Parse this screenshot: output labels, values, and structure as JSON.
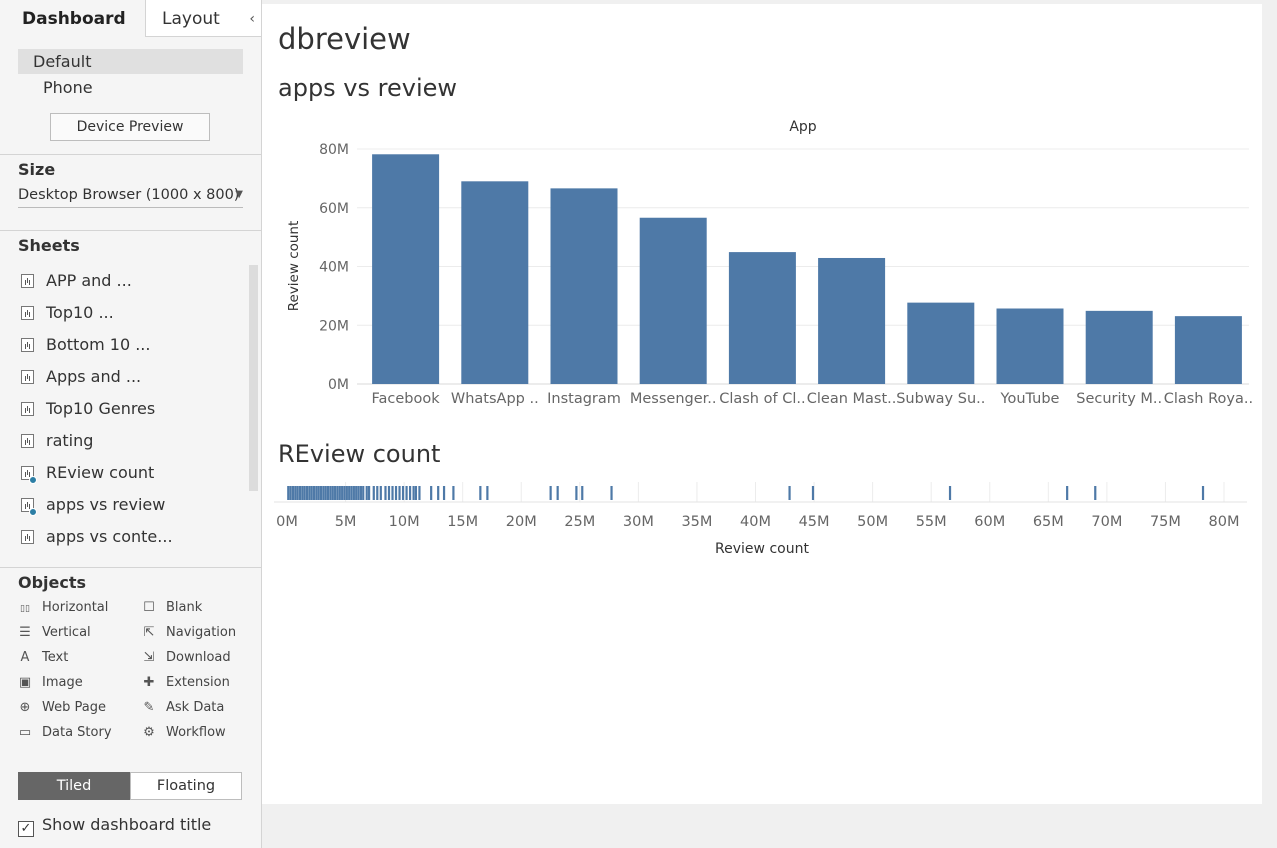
{
  "left_panel": {
    "tabs": {
      "dashboard": "Dashboard",
      "layout": "Layout",
      "collapse": "‹"
    },
    "device": {
      "default": "Default",
      "phone": "Phone",
      "preview_button": "Device Preview"
    },
    "size": {
      "heading": "Size",
      "value": "Desktop Browser (1000 x 800)"
    },
    "sheets": {
      "heading": "Sheets",
      "items": [
        {
          "label": "APP and ...",
          "used": false
        },
        {
          "label": "Top10 ...",
          "used": false
        },
        {
          "label": "Bottom 10 ...",
          "used": false
        },
        {
          "label": "Apps and ...",
          "used": false
        },
        {
          "label": "Top10 Genres",
          "used": false
        },
        {
          "label": "rating",
          "used": false
        },
        {
          "label": "REview count",
          "used": true
        },
        {
          "label": "apps vs review",
          "used": true
        },
        {
          "label": "apps vs conte...",
          "used": false
        }
      ]
    },
    "objects": {
      "heading": "Objects",
      "items": [
        {
          "label": "Horizontal",
          "icon": "horizontal-icon"
        },
        {
          "label": "Blank",
          "icon": "blank-icon"
        },
        {
          "label": "Vertical",
          "icon": "vertical-icon"
        },
        {
          "label": "Navigation",
          "icon": "navigation-icon"
        },
        {
          "label": "Text",
          "icon": "text-icon"
        },
        {
          "label": "Download",
          "icon": "download-icon"
        },
        {
          "label": "Image",
          "icon": "image-icon"
        },
        {
          "label": "Extension",
          "icon": "extension-icon"
        },
        {
          "label": "Web Page",
          "icon": "web-page-icon"
        },
        {
          "label": "Ask Data",
          "icon": "ask-data-icon"
        },
        {
          "label": "Data Story",
          "icon": "data-story-icon"
        },
        {
          "label": "Workflow",
          "icon": "workflow-icon"
        }
      ]
    },
    "mode": {
      "tiled": "Tiled",
      "floating": "Floating",
      "selected": "Tiled"
    },
    "show_title": {
      "label": "Show dashboard title",
      "checked": true
    }
  },
  "dashboard": {
    "title": "dbreview",
    "sheet1_title": "apps vs review",
    "sheet2_title": "REview count"
  },
  "colors": {
    "bar": "#4e79a7",
    "gridline": "#ececec",
    "axis_text": "#666666"
  },
  "chart_data": [
    {
      "type": "bar",
      "title": "apps vs review",
      "header": "App",
      "ylabel": "Review count",
      "xlabel": "",
      "categories": [
        "Facebook",
        "WhatsApp ..",
        "Instagram",
        "Messenger..",
        "Clash of Cl..",
        "Clean Mast..",
        "Subway Su..",
        "YouTube",
        "Security M..",
        "Clash Roya.."
      ],
      "values": [
        78.2,
        69.0,
        66.6,
        56.6,
        44.9,
        42.9,
        27.7,
        25.7,
        24.9,
        23.1
      ],
      "unit": "M",
      "y_ticks": [
        "0M",
        "20M",
        "40M",
        "60M",
        "80M"
      ],
      "ylim": [
        0,
        80
      ],
      "grid": true
    },
    {
      "type": "strip",
      "title": "REview count",
      "xlabel": "Review count",
      "unit": "M",
      "x_ticks": [
        "0M",
        "5M",
        "10M",
        "15M",
        "20M",
        "25M",
        "30M",
        "35M",
        "40M",
        "45M",
        "50M",
        "55M",
        "60M",
        "65M",
        "70M",
        "75M",
        "80M"
      ],
      "xlim": [
        0,
        80
      ],
      "values": [
        0.1,
        0.3,
        0.5,
        0.7,
        0.9,
        1.1,
        1.3,
        1.5,
        1.7,
        1.9,
        2.1,
        2.3,
        2.5,
        2.7,
        2.9,
        3.1,
        3.3,
        3.5,
        3.7,
        3.9,
        4.1,
        4.3,
        4.5,
        4.7,
        4.9,
        5.1,
        5.3,
        5.5,
        5.7,
        5.9,
        6.1,
        6.3,
        6.5,
        6.8,
        7.0,
        7.4,
        7.7,
        8.0,
        8.4,
        8.7,
        9.0,
        9.3,
        9.6,
        9.9,
        10.2,
        10.5,
        10.8,
        11.0,
        11.3,
        12.3,
        12.9,
        13.4,
        14.2,
        16.5,
        17.1,
        22.5,
        23.1,
        24.7,
        25.2,
        27.7,
        42.9,
        44.9,
        56.6,
        66.6,
        69.0,
        78.2
      ]
    }
  ]
}
